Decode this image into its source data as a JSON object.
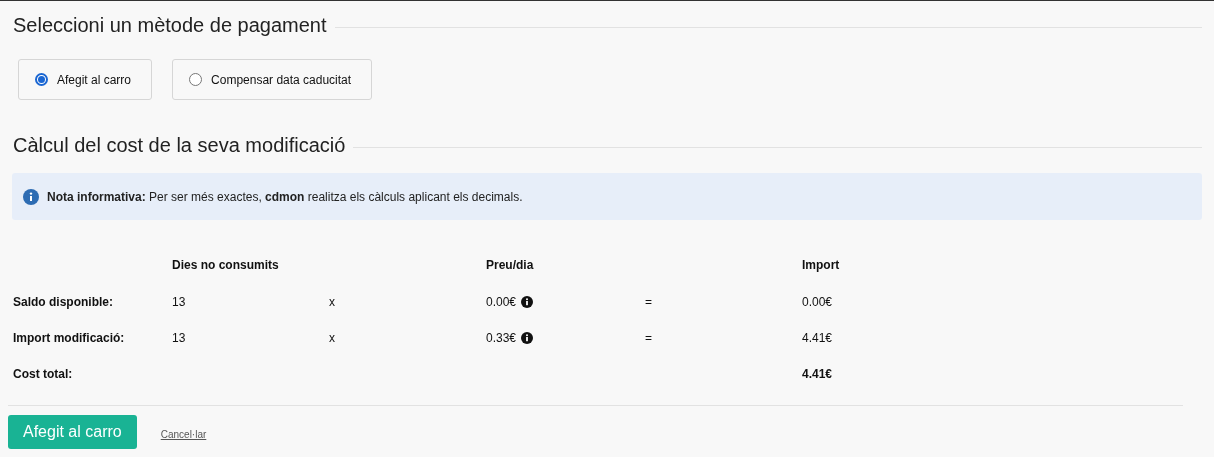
{
  "payment_section": {
    "title": "Seleccioni un mètode de pagament",
    "options": [
      {
        "label": "Afegit al carro",
        "selected": true
      },
      {
        "label": "Compensar data caducitat",
        "selected": false
      }
    ]
  },
  "cost_section": {
    "title": "Càlcul del cost de la seva modificació",
    "note": "**Nota informativa:** Per ser més exactes, **cdmon** realitza els càlculs aplicant els decimals.",
    "table": {
      "columns": [
        "Dies no consumits",
        "Preu/dia",
        "Import"
      ],
      "rows": [
        {
          "kind": "line",
          "label": "Saldo disponible:",
          "days": "13",
          "times": "x",
          "price": "0.00€",
          "equals": "=",
          "amount": "0.00€"
        },
        {
          "kind": "line",
          "label": "Import modificació:",
          "days": "13",
          "times": "x",
          "price": "0.33€",
          "equals": "=",
          "amount": "4.41€"
        },
        {
          "kind": "total",
          "label": "Cost total:",
          "amount": "4.41€"
        }
      ]
    }
  },
  "actions": {
    "primary": "Afegit al carro",
    "cancel": "Cancel·lar"
  }
}
